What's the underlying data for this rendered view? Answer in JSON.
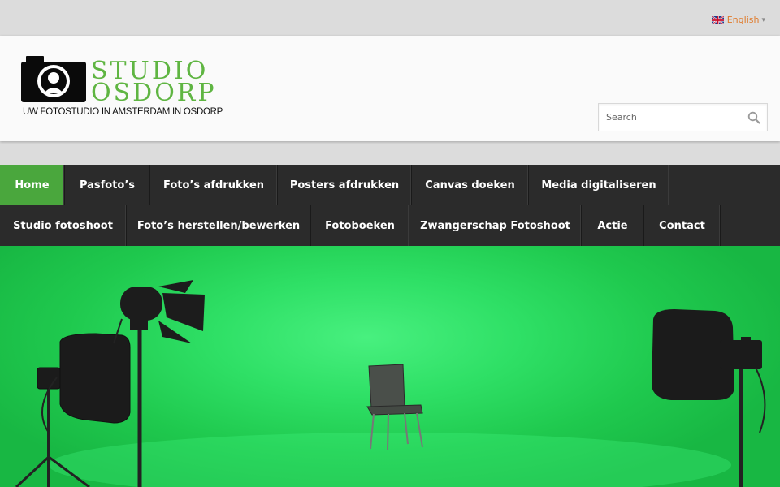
{
  "topbar": {
    "language": {
      "label": "English",
      "caret": "▾",
      "flag_icon": "uk-flag-icon"
    }
  },
  "header": {
    "logo": {
      "title_line1": "STUDIO",
      "title_line2": "OSDORP",
      "tagline": "UW FOTOSTUDIO IN AMSTERDAM IN OSDORP",
      "icon": "camera-person-icon"
    },
    "search": {
      "placeholder": "Search",
      "value": "",
      "icon": "search-icon"
    }
  },
  "nav": {
    "row1": [
      {
        "label": "Home",
        "active": true
      },
      {
        "label": "Pasfoto’s"
      },
      {
        "label": "Foto’s afdrukken"
      },
      {
        "label": "Posters afdrukken"
      },
      {
        "label": "Canvas doeken"
      },
      {
        "label": "Media digitaliseren"
      }
    ],
    "row2": [
      {
        "label": "Studio fotoshoot"
      },
      {
        "label": "Foto’s herstellen/bewerken"
      },
      {
        "label": "Fotoboeken"
      },
      {
        "label": "Zwangerschap Fotoshoot"
      },
      {
        "label": "Actie"
      },
      {
        "label": "Contact"
      }
    ]
  },
  "colors": {
    "accent_green": "#4aa73d",
    "logo_green": "#5fb542",
    "nav_bg": "#2b2b2b",
    "lang_link": "#e07a2a"
  }
}
